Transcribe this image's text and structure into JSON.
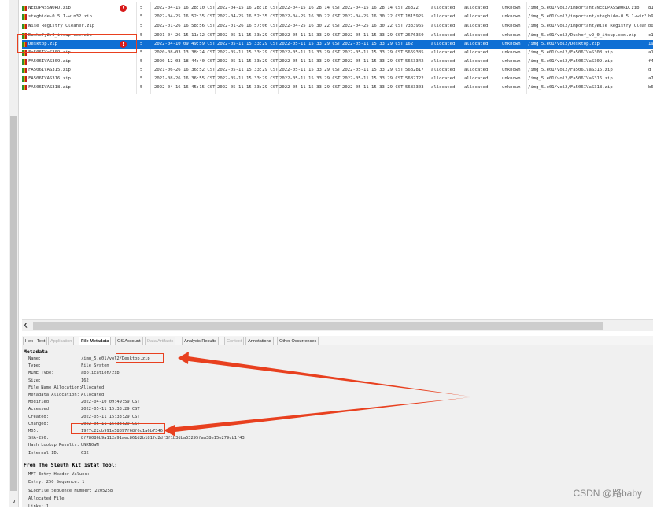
{
  "files": [
    {
      "name": "NEEDPASSWORD.zip",
      "flag": true,
      "s": "5",
      "modified": "2022-04-15 16:28:10 CST",
      "changed": "2022-04-15 16:28:18 CST",
      "accessed": "2022-04-15 16:28:14 CST",
      "created": "2022-04-15 16:28:14 CST",
      "size": "26322",
      "f1": "allocated",
      "f2": "allocated",
      "known": "unknown",
      "path": "/img_5.e01/vol2/important/NEEDPASSWORD.zip",
      "x": "81"
    },
    {
      "name": "steghide-0.5.1-win32.zip",
      "flag": false,
      "s": "5",
      "modified": "2022-04-25 16:52:35 CST",
      "changed": "2022-04-25 16:52:35 CST",
      "accessed": "2022-04-25 16:30:22 CST",
      "created": "2022-04-25 16:30:22 CST",
      "size": "1815925",
      "f1": "allocated",
      "f2": "allocated",
      "known": "unknown",
      "path": "/img_5.e01/vol2/important/steghide-0.5.1-win32.zip",
      "x": "b9"
    },
    {
      "name": "Wise Registry Cleaner.zip",
      "flag": false,
      "s": "5",
      "modified": "2022-01-26 16:58:56 CST",
      "changed": "2022-01-26 16:57:06 CST",
      "accessed": "2022-04-25 16:30:22 CST",
      "created": "2022-04-25 16:30:22 CST",
      "size": "7333965",
      "f1": "allocated",
      "f2": "allocated",
      "known": "unknown",
      "path": "/img_5.e01/vol2/important/Wise Registry Cleane...",
      "x": "b0"
    },
    {
      "name": "Dushofy2.0_itsup.com.zip",
      "flag": false,
      "s": "5",
      "modified": "2021-04-26 15:11:12 CST",
      "changed": "2022-05-11 15:33:29 CST",
      "accessed": "2022-05-11 15:33:29 CST",
      "created": "2022-05-11 15:33:29 CST",
      "size": "2676350",
      "f1": "allocated",
      "f2": "allocated",
      "known": "unknown",
      "path": "/img_5.e01/vol2/Dushof_v2_0_itsup.com.zip",
      "x": "c1"
    },
    {
      "name": "Desktop.zip",
      "flag": true,
      "s": "5",
      "modified": "2022-04-10 09:49:59 CST",
      "changed": "2022-05-11 15:33:29 CST",
      "accessed": "2022-05-11 15:33:29 CST",
      "created": "2022-05-11 15:33:29 CST",
      "size": "162",
      "f1": "allocated",
      "f2": "allocated",
      "known": "unknown",
      "path": "/img_5.e01/vol2/Desktop.zip",
      "x": "19"
    },
    {
      "name": "Fa506IVaS309.zip",
      "flag": false,
      "s": "5",
      "modified": "2020-08-03 13:38:24 CST",
      "changed": "2022-05-11 15:33:29 CST",
      "accessed": "2022-05-11 15:33:29 CST",
      "created": "2022-05-11 15:33:29 CST",
      "size": "5669385",
      "f1": "allocated",
      "f2": "allocated",
      "known": "unknown",
      "path": "/img_5.e01/vol2/Fa506IVaS308.zip",
      "x": "a1"
    },
    {
      "name": "FA506IVAS309.zip",
      "flag": false,
      "s": "5",
      "modified": "2020-12-03 18:44:40 CST",
      "changed": "2022-05-11 15:33:29 CST",
      "accessed": "2022-05-11 15:33:29 CST",
      "created": "2022-05-11 15:33:29 CST",
      "size": "5663342",
      "f1": "allocated",
      "f2": "allocated",
      "known": "unknown",
      "path": "/img_5.e01/vol2/Fa506IVaS309.zip",
      "x": "f4"
    },
    {
      "name": "FA506IVAS315.zip",
      "flag": false,
      "s": "5",
      "modified": "2021-06-26 16:36:52 CST",
      "changed": "2022-05-11 15:33:29 CST",
      "accessed": "2022-05-11 15:33:29 CST",
      "created": "2022-05-11 15:33:29 CST",
      "size": "5682817",
      "f1": "allocated",
      "f2": "allocated",
      "known": "unknown",
      "path": "/img_5.e01/vol2/Fa506IVaS315.zip",
      "x": "d"
    },
    {
      "name": "FA506IVAS316.zip",
      "flag": false,
      "s": "5",
      "modified": "2021-08-26 16:36:55 CST",
      "changed": "2022-05-11 15:33:29 CST",
      "accessed": "2022-05-11 15:33:29 CST",
      "created": "2022-05-11 15:33:29 CST",
      "size": "5682722",
      "f1": "allocated",
      "f2": "allocated",
      "known": "unknown",
      "path": "/img_5.e01/vol2/Fa506IVaS316.zip",
      "x": "a7"
    },
    {
      "name": "FA506IVAS318.zip",
      "flag": false,
      "s": "5",
      "modified": "2022-04-16 16:45:15 CST",
      "changed": "2022-05-11 15:33:29 CST",
      "accessed": "2022-05-11 15:33:29 CST",
      "created": "2022-05-11 15:33:29 CST",
      "size": "5683303",
      "f1": "allocated",
      "f2": "allocated",
      "known": "unknown",
      "path": "/img_5.e01/vol2/Fa506IVaS318.zip",
      "x": "b6"
    }
  ],
  "tabs": [
    {
      "label": "Hex",
      "dim": false,
      "active": false
    },
    {
      "label": "Text",
      "dim": false,
      "active": false
    },
    {
      "label": "Application",
      "dim": true,
      "active": false
    },
    {
      "label": "File Metadata",
      "dim": false,
      "active": true
    },
    {
      "label": "OS Account",
      "dim": false,
      "active": false
    },
    {
      "label": "Data Artifacts",
      "dim": true,
      "active": false
    },
    {
      "label": "Analysis Results",
      "dim": false,
      "active": false
    },
    {
      "label": "Context",
      "dim": true,
      "active": false
    },
    {
      "label": "Annotations",
      "dim": false,
      "active": false
    },
    {
      "label": "Other Occurrences",
      "dim": false,
      "active": false
    }
  ],
  "metadata": {
    "heading": "Metadata",
    "fields": [
      {
        "label": "Name:",
        "value": "/img_5.e01/vol2/Desktop.zip"
      },
      {
        "label": "Type:",
        "value": "File System"
      },
      {
        "label": "MIME Type:",
        "value": "application/zip"
      },
      {
        "label": "Size:",
        "value": "162"
      },
      {
        "label": "File Name Allocation:",
        "value": "Allocated"
      },
      {
        "label": "Metadata Allocation:",
        "value": "Allocated"
      },
      {
        "label": "Modified:",
        "value": "2022-04-10 09:49:59 CST"
      },
      {
        "label": "Accessed:",
        "value": "2022-05-11 15:33:29 CST"
      },
      {
        "label": "Created:",
        "value": "2022-05-11 15:33:29 CST"
      },
      {
        "label": "Changed:",
        "value": "2022-05-11 15:33:29 CST"
      },
      {
        "label": "MD5:",
        "value": "19f7c22cb991e58897f68f6c1a6b7346"
      },
      {
        "label": "SHA-256:",
        "value": "8f78086b9a112a91aec861d2b181fd2df3f1b3dba53295faa38e15e279cb1f43"
      },
      {
        "label": "Hash Lookup Results:",
        "value": "UNKNOWN"
      },
      {
        "label": "Internal ID:",
        "value": "632"
      }
    ],
    "tsk_heading": "From The Sleuth Kit istat Tool:",
    "tsk_lines": [
      "MFT Entry Header Values:",
      "Entry: 250 Sequence: 1",
      "$LogFile Sequence Number: 2205258",
      "Allocated File",
      "Links: 1"
    ]
  },
  "annotation_color": "#e8401f",
  "watermark": "CSDN @路baby"
}
